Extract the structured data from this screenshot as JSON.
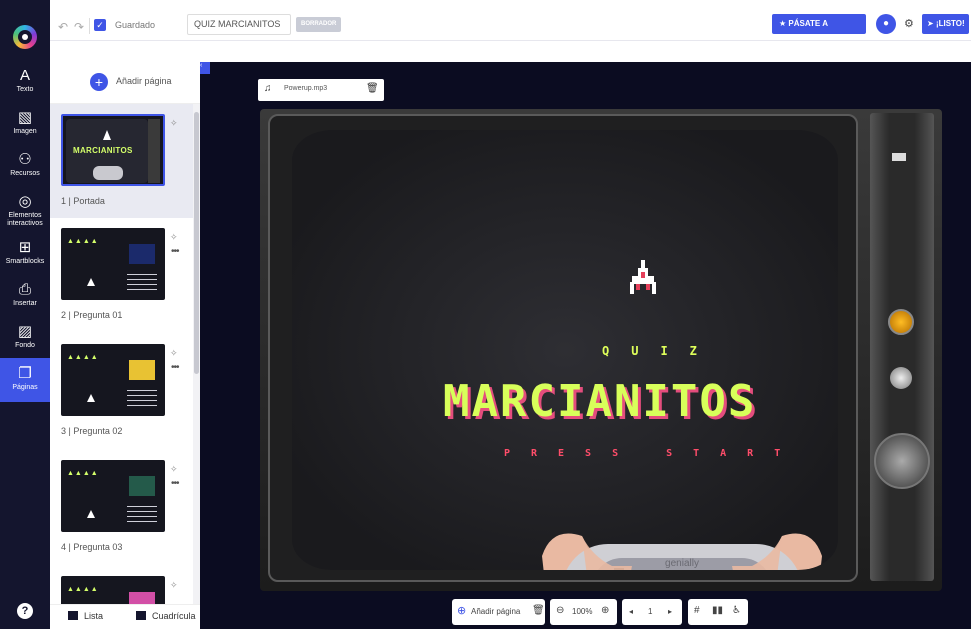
{
  "rail": {
    "items": [
      {
        "label": "Texto",
        "icon": "text-icon"
      },
      {
        "label": "Imagen",
        "icon": "image-icon"
      },
      {
        "label": "Recursos",
        "icon": "resources-icon"
      },
      {
        "label": "Elementos interactivos",
        "icon": "interactive-icon"
      },
      {
        "label": "Smartblocks",
        "icon": "smartblocks-icon"
      },
      {
        "label": "Insertar",
        "icon": "insert-icon"
      },
      {
        "label": "Fondo",
        "icon": "background-icon"
      },
      {
        "label": "Páginas",
        "icon": "pages-icon",
        "active": true
      }
    ],
    "help": "?"
  },
  "topbar": {
    "saved_label": "Guardado",
    "title_value": "QUIZ MARCIANITOS",
    "draft_badge": "BORRADOR",
    "premium_label": "PÁSATE A PREMIUM",
    "ready_label": "¡LISTO!"
  },
  "panel": {
    "add_page_label": "Añadir página",
    "pages": [
      {
        "label": "1 | Portada",
        "thumb_title": "MARCIANITOS"
      },
      {
        "label": "2 | Pregunta 01"
      },
      {
        "label": "3 | Pregunta 02"
      },
      {
        "label": "4 | Pregunta 03"
      }
    ],
    "tab_list": "Lista",
    "tab_grid": "Cuadrícula"
  },
  "canvas": {
    "audio_name": "Powerup.mp3",
    "quiz_text": "QUIZ",
    "title_text": "MARCIANITOS",
    "press_text": "PRESS START",
    "controller_brand": "genially"
  },
  "bottombar": {
    "add_page_label": "Añadir página",
    "zoom": "100%",
    "page_number": "1"
  },
  "colors": {
    "accent": "#3f55e6",
    "rail_bg": "#14152e",
    "canvas_bg": "#0b0c21",
    "title_green": "#d8ff5a",
    "press_red": "#ff4d6a"
  }
}
